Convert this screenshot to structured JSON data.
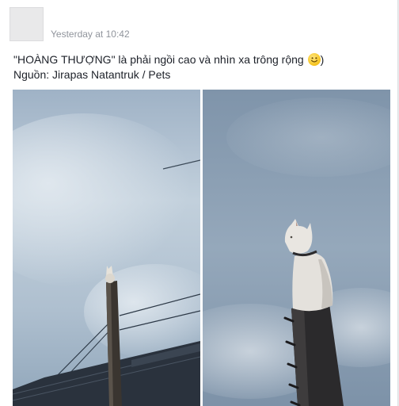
{
  "post": {
    "timestamp": "Yesterday at 10:42",
    "text_line1": "\"HOÀNG THƯỢNG\" là phải ngồi cao và nhìn xa trông rộng",
    "text_line1_end": ")",
    "text_line2": "Nguồn: Jirapas Natantruk / Pets",
    "emoji_icon": "smiley-emoji-icon",
    "photos": [
      {
        "name": "cat-on-pole-wide-photo",
        "sky_color": "#b8c8d6"
      },
      {
        "name": "cat-on-pole-closeup-photo",
        "sky_color": "#8fa3b6"
      }
    ]
  }
}
